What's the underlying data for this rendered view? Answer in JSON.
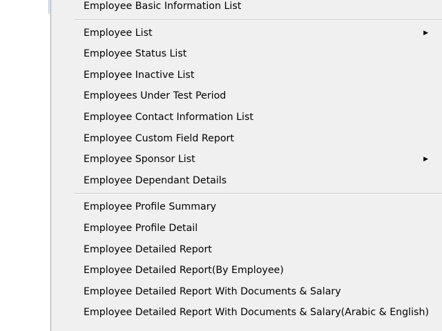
{
  "menu": {
    "items": [
      {
        "label": "Employee Basic Information List",
        "submenu": false
      },
      {
        "separator": true
      },
      {
        "label": "Employee List",
        "submenu": true,
        "arrow_icon": "chevron-right-icon"
      },
      {
        "label": "Employee Status List",
        "submenu": false
      },
      {
        "label": "Employee Inactive List",
        "submenu": false
      },
      {
        "label": "Employees Under Test Period",
        "submenu": false
      },
      {
        "label": "Employee Contact Information List",
        "submenu": false
      },
      {
        "label": "Employee Custom Field Report",
        "submenu": false
      },
      {
        "label": "Employee Sponsor List",
        "submenu": true,
        "arrow_icon": "chevron-right-icon"
      },
      {
        "label": "Employee Dependant Details",
        "submenu": false
      },
      {
        "separator": true
      },
      {
        "label": "Employee Profile Summary",
        "submenu": false
      },
      {
        "label": "Employee Profile Detail",
        "submenu": false
      },
      {
        "label": "Employee Detailed Report",
        "submenu": false
      },
      {
        "label": "Employee Detailed Report(By Employee)",
        "submenu": false
      },
      {
        "label": "Employee Detailed Report With Documents & Salary",
        "submenu": false
      },
      {
        "label": "Employee Detailed Report With Documents & Salary(Arabic & English)",
        "submenu": false
      }
    ],
    "arrow_glyph": "▶",
    "colors": {
      "background": "#f0f0f0",
      "text": "#000000",
      "separator": "#c8c8c8",
      "border": "#a0a0a0"
    }
  }
}
